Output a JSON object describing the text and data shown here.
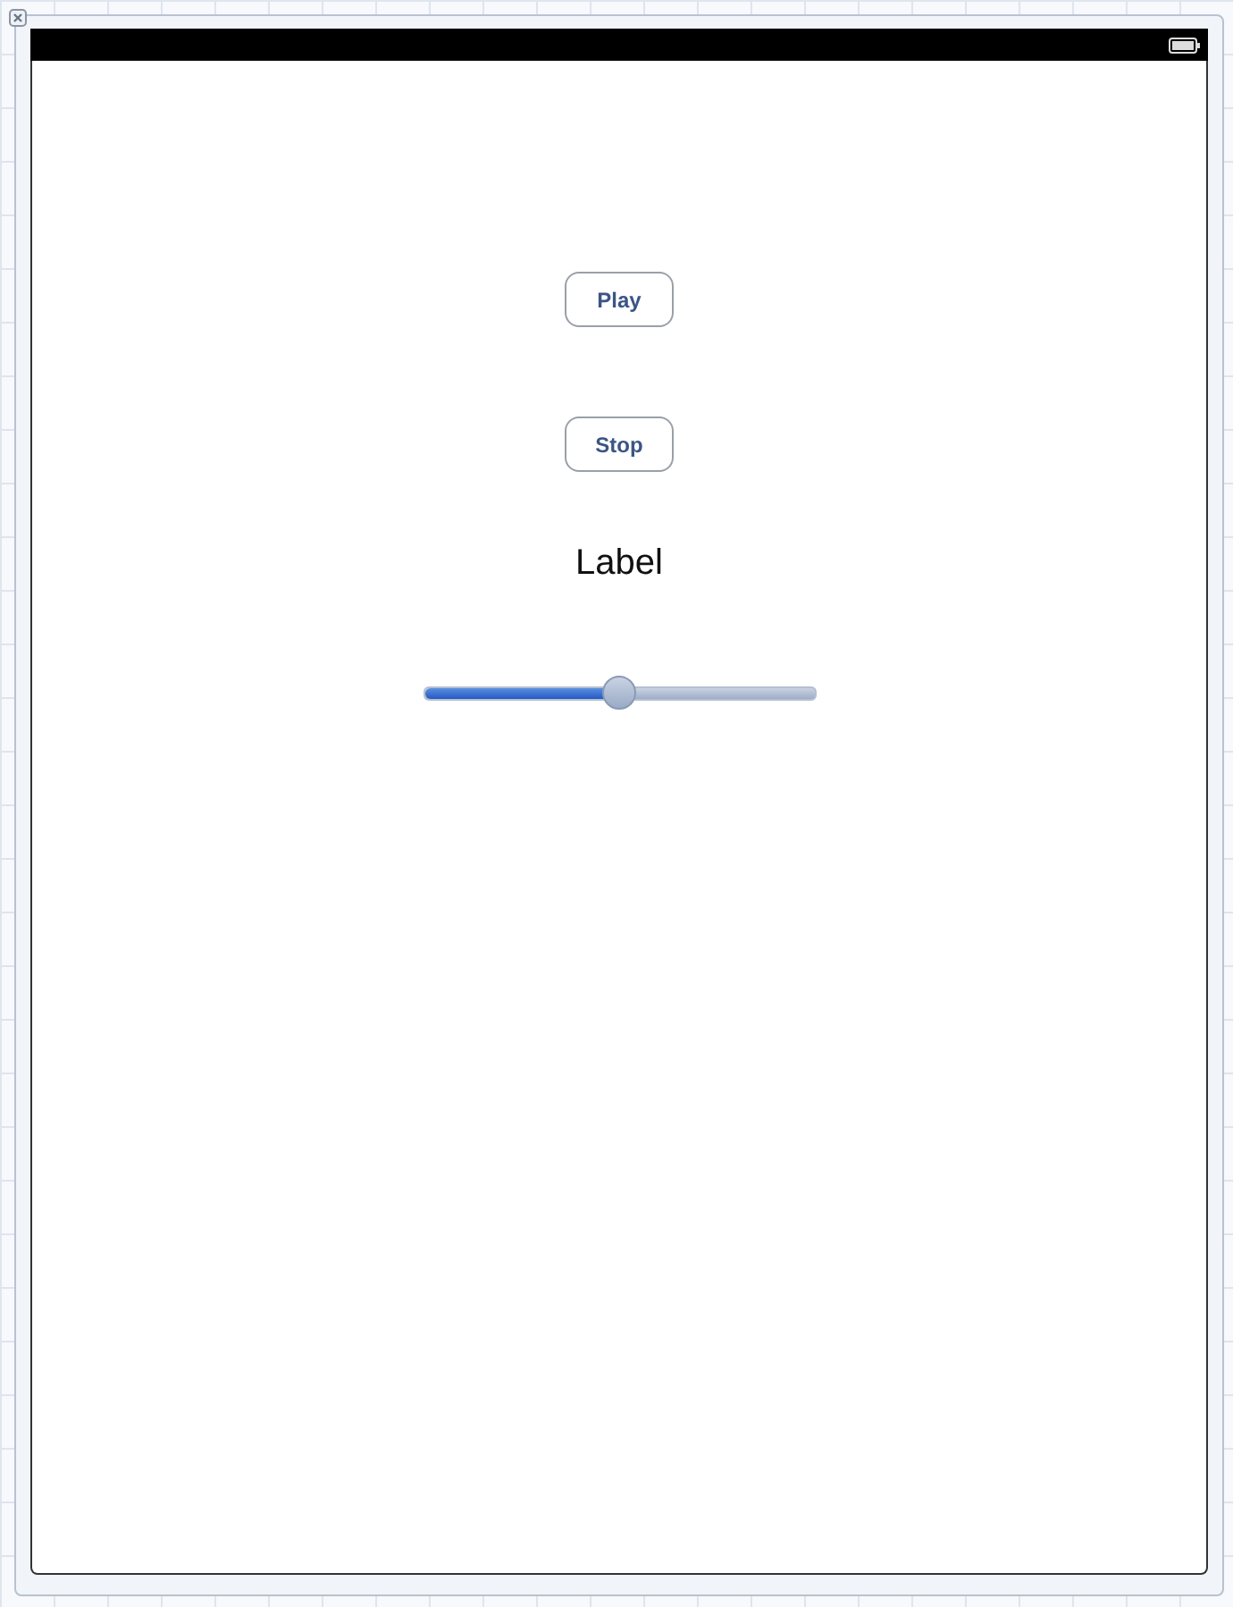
{
  "buttons": [
    {
      "label": "Play"
    },
    {
      "label": "Stop"
    }
  ],
  "label": {
    "text": "Label"
  },
  "slider": {
    "level": 0.5
  }
}
